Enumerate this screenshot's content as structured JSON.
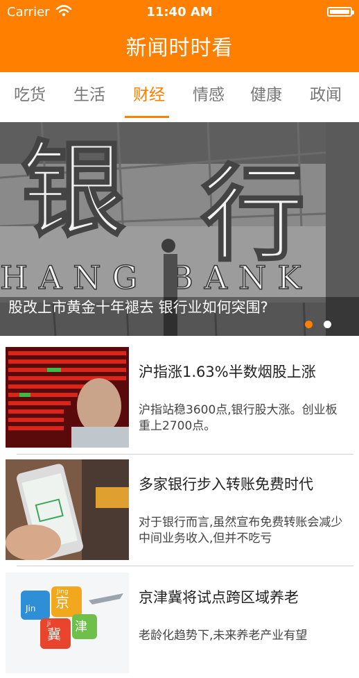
{
  "status_bar": {
    "carrier": "Carrier",
    "time": "11:40 AM"
  },
  "nav": {
    "title": "新闻时时看"
  },
  "tabs": [
    {
      "label": "吃货"
    },
    {
      "label": "生活"
    },
    {
      "label": "财经",
      "active": true
    },
    {
      "label": "情感"
    },
    {
      "label": "健康"
    },
    {
      "label": "政闻"
    }
  ],
  "banner": {
    "caption": "股改上市黄金十年褪去 银行业如何突围?",
    "sign_chars": "银行",
    "sign_latin": "HANG BANK",
    "active_dot": 1,
    "dot_count": 2
  },
  "news": [
    {
      "title": "沪指涨1.63%半数烟股上涨",
      "desc": "沪指站稳3600点,银行股大涨。创业板重上2700点。"
    },
    {
      "title": "多家银行步入转账免费时代",
      "desc": "对于银行而言,虽然宣布免费转账会减少中间业务收入,但并不吃亏"
    },
    {
      "title": "京津冀将试点跨区域养老",
      "desc": "老龄化趋势下,未来养老产业有望"
    }
  ],
  "thumb_labels": {
    "jing": "京",
    "jin": "津",
    "ji": "冀",
    "jing_py": "Jing",
    "jin_py": "Jin",
    "ji_py": "Ji"
  },
  "colors": {
    "brand": "#ff7f00",
    "tab_inactive": "#777777"
  }
}
